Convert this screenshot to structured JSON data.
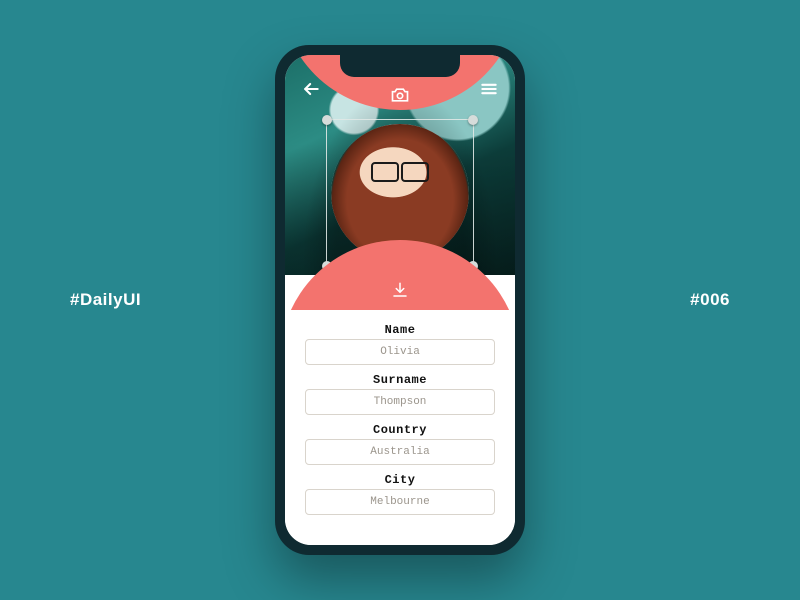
{
  "sideLabels": {
    "left": "#DailyUI",
    "right": "#006"
  },
  "colors": {
    "accent": "#f3736e",
    "bg": "#27878f"
  },
  "icons": {
    "back": "back-arrow-icon",
    "menu": "hamburger-icon",
    "camera": "camera-icon",
    "download": "download-icon"
  },
  "form": {
    "fields": [
      {
        "label": "Name",
        "value": "Olivia"
      },
      {
        "label": "Surname",
        "value": "Thompson"
      },
      {
        "label": "Country",
        "value": "Australia"
      },
      {
        "label": "City",
        "value": "Melbourne"
      }
    ]
  }
}
